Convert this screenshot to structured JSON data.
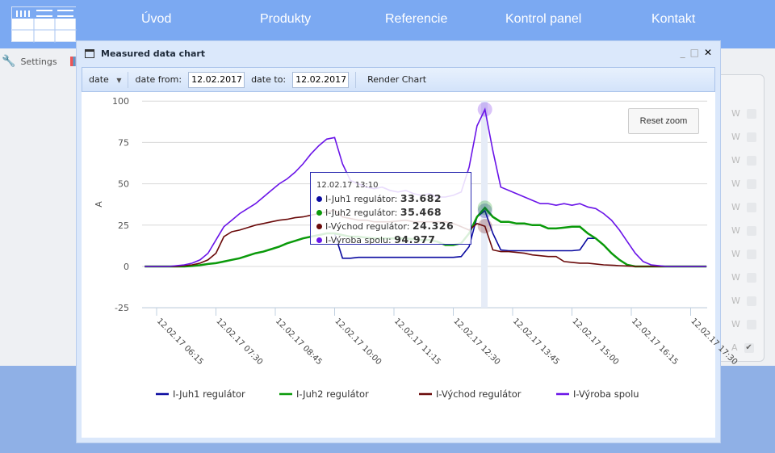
{
  "nav": {
    "items": [
      "Úvod",
      "Produkty",
      "Referencie",
      "Kontrol panel",
      "Kontakt"
    ]
  },
  "sidebar": {
    "settings_label": "Settings"
  },
  "right_panel": {
    "rows": [
      "W",
      "W",
      "W",
      "W",
      "W",
      "W",
      "W",
      "W",
      "W",
      "W",
      "A"
    ],
    "checked": [
      false,
      false,
      false,
      false,
      false,
      false,
      false,
      false,
      false,
      false,
      true
    ]
  },
  "window": {
    "title": "Measured data chart"
  },
  "toolbar": {
    "mode": "date",
    "date_from_label": "date from:",
    "date_from": "12.02.2017",
    "date_to_label": "date to:",
    "date_to": "12.02.2017",
    "render_label": "Render Chart"
  },
  "chart": {
    "reset_zoom": "Reset zoom"
  },
  "tooltip": {
    "time": "12.02.17 13:10",
    "rows": [
      {
        "label": "I-Juh1 regulátor:",
        "value": "33.682"
      },
      {
        "label": "I-Juh2 regulátor:",
        "value": "35.468"
      },
      {
        "label": "I-Východ regulátor:",
        "value": "24.326"
      },
      {
        "label": "I-Výroba spolu:",
        "value": "94.977"
      }
    ]
  },
  "chart_data": {
    "type": "line",
    "ylabel": "A",
    "ylim": [
      -25,
      100
    ],
    "yticks": [
      -25,
      0,
      25,
      50,
      75,
      100
    ],
    "grid": "horizontal",
    "legend": "bottom",
    "xtick_labels": [
      "12.02.17 06:15",
      "12.02.17 07:30",
      "12.02.17 08:45",
      "12.02.17 10:00",
      "12.02.17 11:15",
      "12.02.17 12:30",
      "12.02.17 13:45",
      "12.02.17 15:00",
      "12.02.17 16:15",
      "12.02.17 17:30"
    ],
    "x": [
      "06:00",
      "06:10",
      "06:20",
      "06:30",
      "06:40",
      "06:50",
      "07:00",
      "07:10",
      "07:20",
      "07:30",
      "07:40",
      "07:50",
      "08:00",
      "08:10",
      "08:20",
      "08:30",
      "08:40",
      "08:50",
      "09:00",
      "09:10",
      "09:20",
      "09:30",
      "09:40",
      "09:50",
      "10:00",
      "10:10",
      "10:20",
      "10:30",
      "10:40",
      "10:50",
      "11:00",
      "11:10",
      "11:20",
      "11:30",
      "11:40",
      "11:50",
      "12:00",
      "12:10",
      "12:20",
      "12:30",
      "12:40",
      "12:50",
      "13:00",
      "13:10",
      "13:20",
      "13:30",
      "13:40",
      "13:50",
      "14:00",
      "14:10",
      "14:20",
      "14:30",
      "14:40",
      "14:50",
      "15:00",
      "15:10",
      "15:20",
      "15:30",
      "15:40",
      "15:50",
      "16:00",
      "16:10",
      "16:20",
      "16:30",
      "16:40",
      "16:50",
      "17:00",
      "17:10",
      "17:20",
      "17:30",
      "17:40",
      "17:50"
    ],
    "series": [
      {
        "name": "I-Juh1 regulátor",
        "color": "#0a0aa0",
        "values": [
          0,
          0,
          0,
          0,
          0,
          0,
          0.3,
          0.8,
          1.5,
          2,
          3,
          4,
          5,
          6.5,
          8,
          9,
          10.5,
          12,
          14,
          15.5,
          17,
          18,
          19,
          20,
          20,
          5,
          5,
          5.5,
          5.5,
          5.5,
          5.5,
          5.5,
          5.5,
          5.5,
          5.5,
          5.5,
          5.5,
          5.5,
          5.5,
          5.5,
          6,
          12,
          30,
          33.682,
          20,
          10,
          9.5,
          9.5,
          9.5,
          9.5,
          9.5,
          9.5,
          9.5,
          9.5,
          9.5,
          10,
          17,
          17,
          13,
          8,
          4,
          1,
          0,
          0,
          0,
          0,
          0,
          0,
          0,
          0,
          0,
          0
        ]
      },
      {
        "name": "I-Juh2 regulátor",
        "color": "#0a9a0a",
        "values": [
          0,
          0,
          0,
          0,
          0,
          0,
          0.3,
          0.8,
          1.5,
          2,
          3,
          4,
          5,
          6.5,
          8,
          9,
          10.5,
          12,
          14,
          15.5,
          17,
          18,
          19,
          20,
          20,
          19,
          18,
          18,
          17.5,
          17,
          17,
          17,
          17,
          17,
          16.5,
          16,
          16,
          15,
          13,
          13,
          14,
          20,
          30,
          35.468,
          30,
          27,
          27,
          26,
          26,
          25,
          25,
          23,
          23,
          23.5,
          24,
          24,
          20,
          17,
          13,
          8,
          4,
          1,
          0,
          0,
          0,
          0,
          0,
          0,
          0,
          0,
          0,
          0
        ]
      },
      {
        "name": "I-Východ regulátor",
        "color": "#6a0a0a",
        "values": [
          0,
          0,
          0,
          0,
          0,
          0.5,
          1,
          2,
          4,
          8,
          18,
          21,
          22,
          23.5,
          25,
          26,
          27,
          28,
          28.5,
          29.5,
          30,
          31,
          32,
          33,
          34,
          30,
          29,
          28,
          28,
          27,
          27,
          27,
          27.5,
          28,
          27,
          27,
          27,
          27,
          27,
          26,
          24,
          22,
          26,
          24.326,
          10,
          9,
          9,
          8.5,
          8,
          7,
          6.5,
          6,
          6,
          3,
          2.5,
          2,
          2,
          1.5,
          1,
          0.8,
          0.5,
          0.3,
          0,
          0,
          0,
          0,
          0,
          0,
          0,
          0,
          0,
          0
        ]
      },
      {
        "name": "I-Výroba spolu",
        "color": "#6a14e8",
        "values": [
          0,
          0,
          0,
          0,
          0.5,
          1,
          2,
          4,
          8,
          16,
          24,
          28,
          32,
          35,
          38,
          42,
          46,
          50,
          53,
          57,
          62,
          68,
          73,
          77,
          78,
          62,
          52,
          50,
          48,
          47,
          48,
          46,
          45,
          46,
          44,
          43,
          44,
          42,
          42,
          43,
          45,
          60,
          85,
          94.977,
          70,
          48,
          46,
          44,
          42,
          40,
          38,
          38,
          37,
          38,
          37,
          38,
          36,
          35,
          32,
          28,
          22,
          15,
          8,
          3,
          1,
          0.5,
          0,
          0,
          0,
          0,
          0,
          0
        ]
      }
    ]
  }
}
